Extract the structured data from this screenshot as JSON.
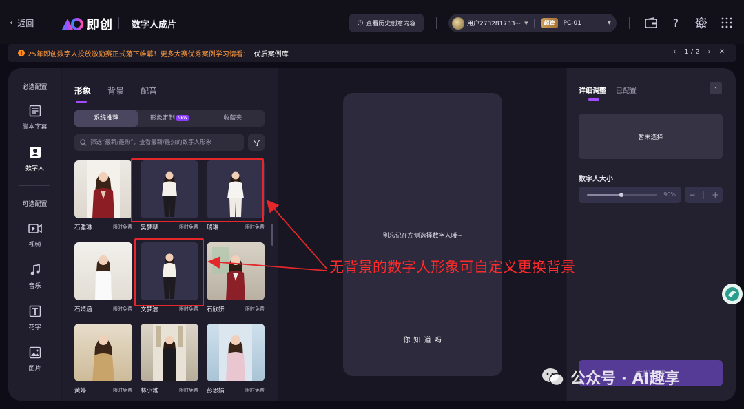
{
  "header": {
    "back_label": "返回",
    "logo_text": "即创",
    "page_title": "数字人成片",
    "history_button": "查看历史创意内容",
    "user_name": "用户273281733···",
    "vip_badge": "超管",
    "pc_label": "PC-01"
  },
  "notice": {
    "text": "25年即创数字人投放激励赛正式落下帷幕！更多大赛优秀案例学习请看：",
    "link": "优质案例库",
    "page_indicator": "1 / 2"
  },
  "leftnav": {
    "required_title": "必选配置",
    "optional_title": "可选配置",
    "items": [
      {
        "label": "脚本字幕",
        "icon": "script-icon"
      },
      {
        "label": "数字人",
        "icon": "avatar-person-icon"
      },
      {
        "label": "视频",
        "icon": "video-icon"
      },
      {
        "label": "音乐",
        "icon": "music-icon"
      },
      {
        "label": "花字",
        "icon": "text-style-icon"
      },
      {
        "label": "图片",
        "icon": "image-icon"
      }
    ]
  },
  "asset_panel": {
    "tabs": [
      "形象",
      "背景",
      "配音"
    ],
    "segments": [
      "系统推荐",
      "形象定制",
      "收藏夹"
    ],
    "new_tag": "NEW",
    "search_placeholder": "筛选“最新/最热”，查看最新/最热的数字人形象",
    "free_label": "限时免费",
    "avatars": [
      {
        "name": "石雅琳",
        "style": "photo"
      },
      {
        "name": "吴梦琴",
        "style": "plain"
      },
      {
        "name": "瑞琳",
        "style": "plain"
      },
      {
        "name": "石婧涵",
        "style": "photo"
      },
      {
        "name": "文梦洁",
        "style": "plain"
      },
      {
        "name": "石欣妍",
        "style": "photo"
      },
      {
        "name": "黄婷",
        "style": "photo"
      },
      {
        "name": "林小雅",
        "style": "photo"
      },
      {
        "name": "彭思娟",
        "style": "photo"
      }
    ]
  },
  "preview": {
    "hint": "别忘记在左侧选择数字人哦~",
    "subtitle": "你 知 道 吗"
  },
  "right_panel": {
    "tabs": [
      "详细调整",
      "已配置"
    ],
    "empty_text": "暂未选择",
    "size_label": "数字人大小",
    "size_value_text": "90%",
    "size_value": 0.9,
    "generate_button": "立即生成"
  },
  "annotation": {
    "text": "无背景的数字人形象可自定义更换背景",
    "color": "#ff2a2a"
  },
  "watermark": {
    "text": "公众号 · AI趣享"
  },
  "colors": {
    "accent": "#a44bff",
    "notice": "#ff9a3c",
    "annotation_red": "#e3272b"
  }
}
